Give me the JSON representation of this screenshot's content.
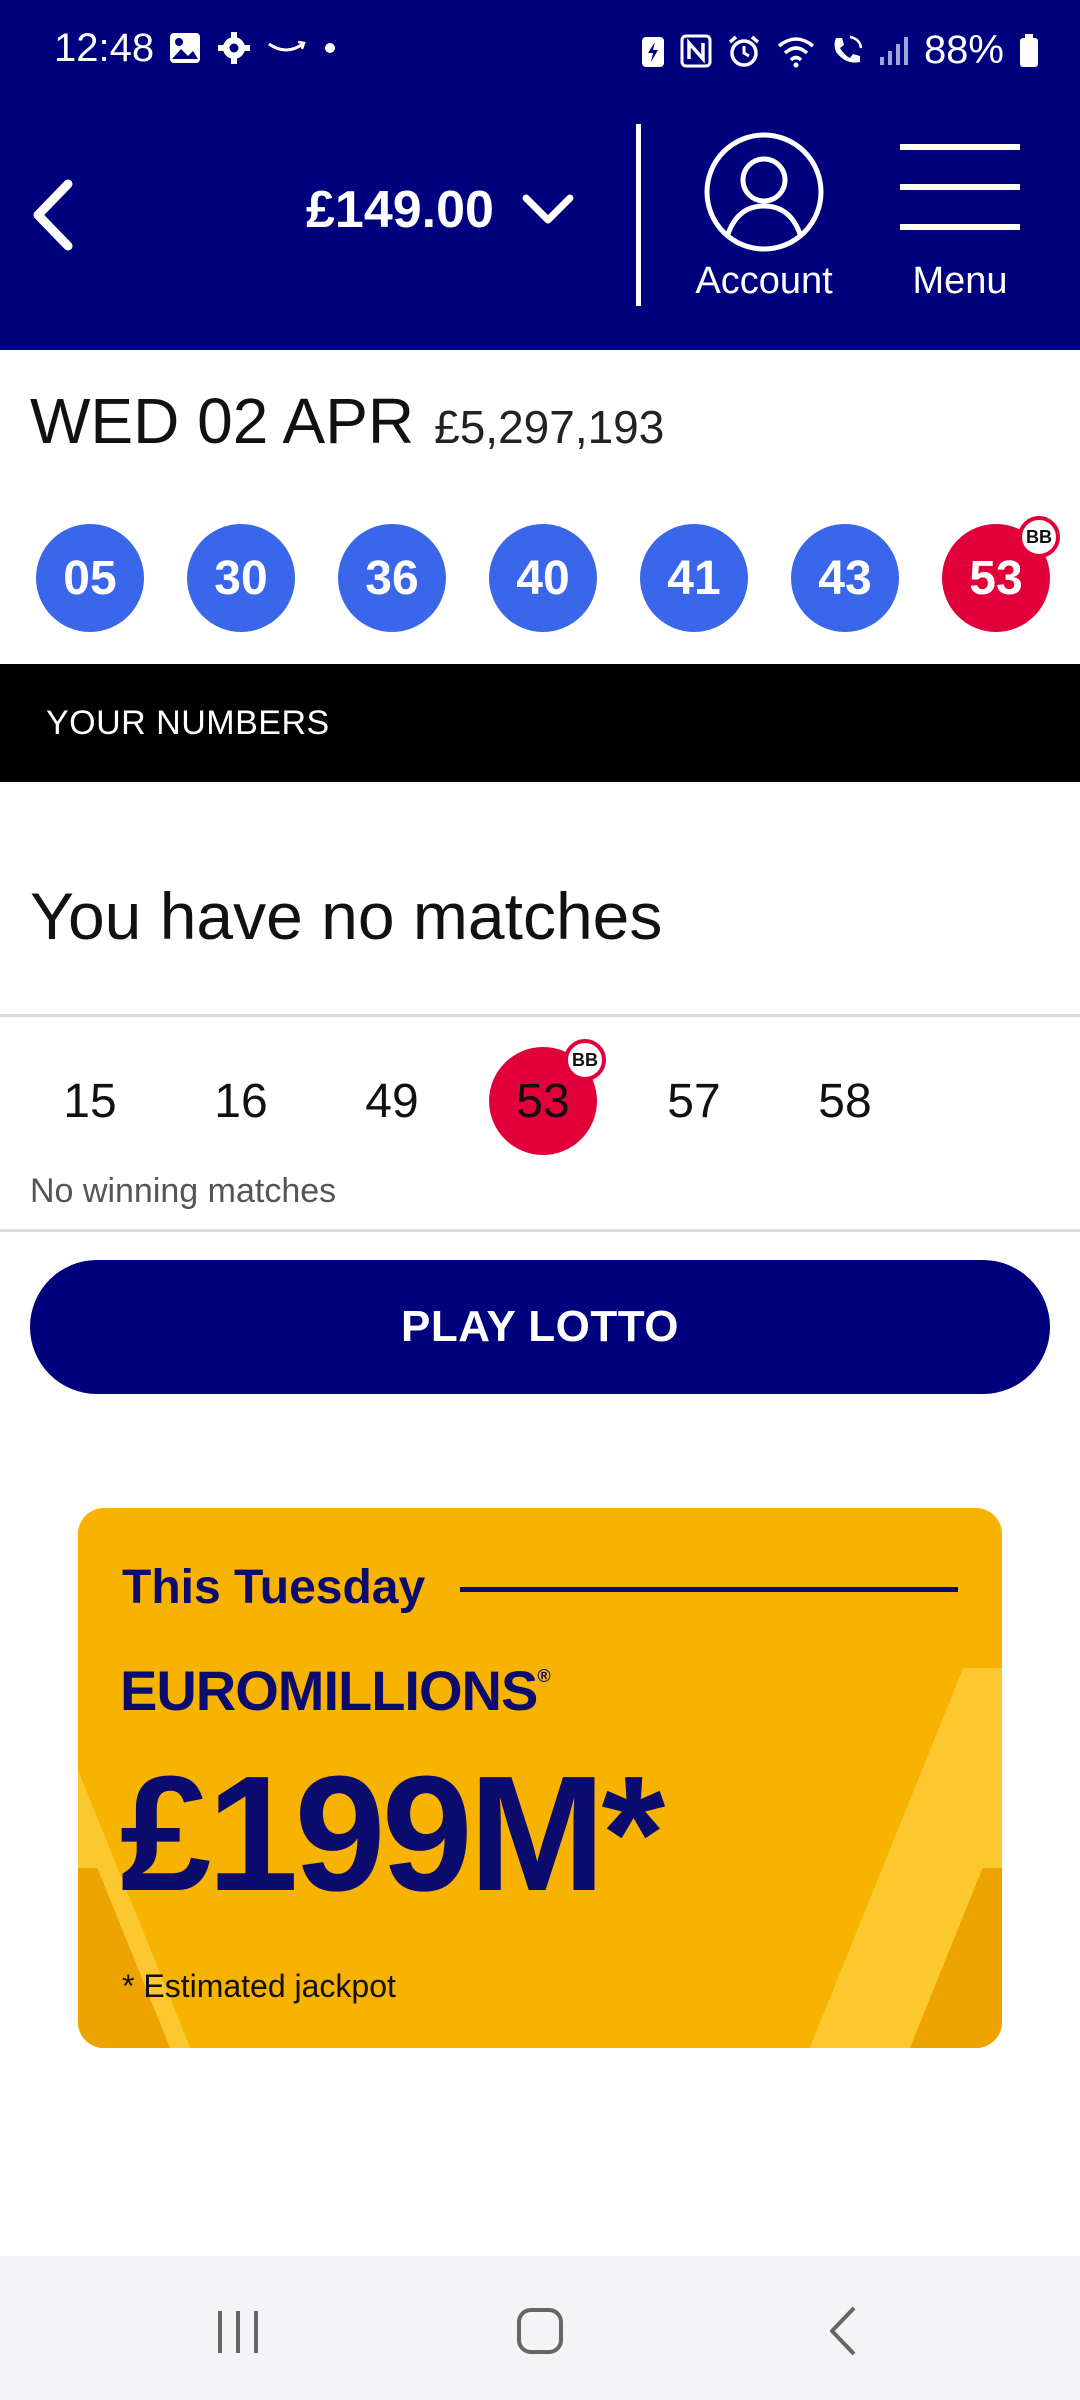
{
  "status_bar": {
    "time": "12:48",
    "battery": "88%",
    "left_icons": [
      "gallery-icon",
      "settings-icon",
      "amazon-icon",
      "dot-icon"
    ],
    "right_icons": [
      "battery-saver-icon",
      "nfc-icon",
      "alarm-icon",
      "wifi-icon",
      "wifi-call-icon",
      "signal-icon",
      "battery-icon"
    ]
  },
  "header": {
    "balance": "£149.00",
    "account_label": "Account",
    "menu_label": "Menu",
    "bg_color": "#00017d"
  },
  "draw": {
    "date": "WED 02 APR",
    "jackpot": "£5,297,193",
    "balls": [
      "05",
      "30",
      "36",
      "40",
      "41",
      "43"
    ],
    "bonus_ball": "53",
    "bonus_label": "BB",
    "ball_color": "#3a66ea",
    "bonus_color": "#e2003a"
  },
  "your_numbers": {
    "section_title": "YOUR NUMBERS",
    "result_title": "You have no matches",
    "numbers": [
      "15",
      "16",
      "49",
      "53",
      "57",
      "58"
    ],
    "matched_index": 3,
    "matched_label": "BB",
    "status": "No winning matches"
  },
  "play_button": {
    "label": "PLAY LOTTO"
  },
  "promo": {
    "day": "This Tuesday",
    "brand": "EUROMILLIONS",
    "brand_mark": "®",
    "jackpot": "£199M*",
    "footnote": "* Estimated jackpot",
    "bg_color": "#f8b200",
    "text_color": "#0c0b6e"
  },
  "nav_bar": {
    "buttons": [
      "recent-apps-icon",
      "home-icon",
      "back-icon"
    ]
  }
}
